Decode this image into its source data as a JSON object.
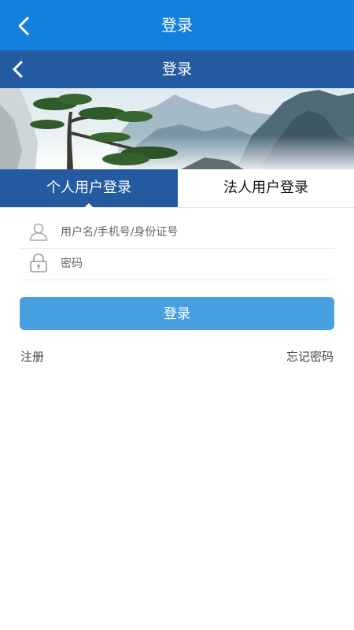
{
  "topbar": {
    "title": "登录"
  },
  "navbar": {
    "title": "登录"
  },
  "tabs": [
    {
      "label": "个人用户登录",
      "active": true
    },
    {
      "label": "法人用户登录",
      "active": false
    }
  ],
  "form": {
    "username": {
      "placeholder": "用户名/手机号/身份证号",
      "value": ""
    },
    "password": {
      "placeholder": "密码",
      "value": ""
    }
  },
  "login_button": "登录",
  "links": {
    "register": "注册",
    "forgot": "忘记密码"
  },
  "colors": {
    "topbar": "#1380dd",
    "navbar": "#245aa0",
    "tab_active": "#245aa0",
    "button": "#49a0e0"
  },
  "icons": {
    "back": "chevron-left-icon",
    "user": "user-icon",
    "lock": "lock-icon"
  }
}
